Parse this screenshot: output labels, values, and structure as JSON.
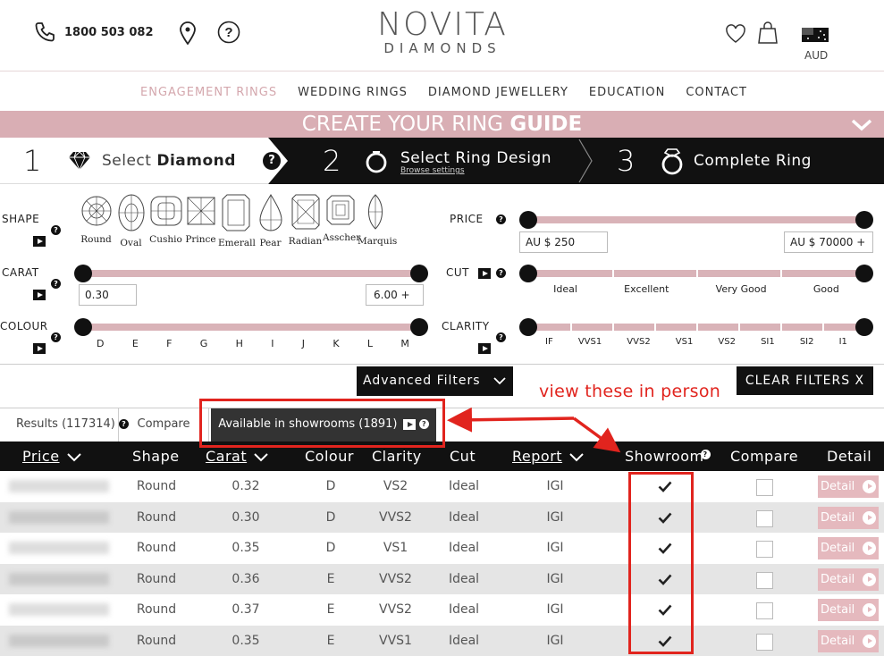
{
  "header": {
    "phone": "1800 503 082",
    "logo_line1": "NOVITA",
    "logo_line2": "DIAMONDS",
    "currency": "AUD",
    "icons": [
      "phone-icon",
      "location-pin-icon",
      "help-icon",
      "heart-icon",
      "shopping-bag-icon",
      "australia-flag-icon"
    ]
  },
  "nav": {
    "items": [
      "ENGAGEMENT RINGS",
      "WEDDING RINGS",
      "DIAMOND JEWELLERY",
      "EDUCATION",
      "CONTACT"
    ]
  },
  "guide": {
    "title_light": "CREATE YOUR RING ",
    "title_bold": "GUIDE"
  },
  "steps": [
    {
      "num": "1",
      "light": "Select ",
      "bold": "Diamond"
    },
    {
      "num": "2",
      "light": "Select ",
      "bold": "Ring Design",
      "sub": "Browse settings"
    },
    {
      "num": "3",
      "light": "Complete ",
      "bold": "Ring"
    }
  ],
  "filters": {
    "shape_label": "SHAPE",
    "shapes": [
      "Round",
      "Oval",
      "Cushio",
      "Prince",
      "Emerall",
      "Pear",
      "Radian",
      "Asscher",
      "Marquis"
    ],
    "carat_label": "CARAT",
    "carat_min": "0.30",
    "carat_max": "6.00 +",
    "colour_label": "COLOUR",
    "colours": [
      "D",
      "E",
      "F",
      "G",
      "H",
      "I",
      "J",
      "K",
      "L",
      "M"
    ],
    "price_label": "PRICE",
    "price_min": "AU $ 250",
    "price_max": "AU $ 70000 +",
    "cut_label": "CUT",
    "cuts": [
      "Ideal",
      "Excellent",
      "Very Good",
      "Good"
    ],
    "clarity_label": "CLARITY",
    "clarities": [
      "IF",
      "VVS1",
      "VVS2",
      "VS1",
      "VS2",
      "SI1",
      "SI2",
      "I1"
    ]
  },
  "actions": {
    "advanced": "Advanced Filters",
    "clear": "CLEAR FILTERS X"
  },
  "annotation": {
    "text": "view these in person",
    "color": "#e1241e"
  },
  "tabs": {
    "results": "Results (117314)",
    "compare": "Compare",
    "showrooms": "Available in showrooms (1891)"
  },
  "table": {
    "headers": {
      "price": "Price",
      "shape": "Shape",
      "carat": "Carat",
      "colour": "Colour",
      "clarity": "Clarity",
      "cut": "Cut",
      "report": "Report",
      "showroom": "Showroom",
      "compare": "Compare",
      "detail": "Detail"
    },
    "detail_label": "Detail",
    "rows": [
      {
        "shape": "Round",
        "carat": "0.32",
        "colour": "D",
        "clarity": "VS2",
        "cut": "Ideal",
        "report": "IGI"
      },
      {
        "shape": "Round",
        "carat": "0.30",
        "colour": "D",
        "clarity": "VVS2",
        "cut": "Ideal",
        "report": "IGI"
      },
      {
        "shape": "Round",
        "carat": "0.35",
        "colour": "D",
        "clarity": "VS1",
        "cut": "Ideal",
        "report": "IGI"
      },
      {
        "shape": "Round",
        "carat": "0.36",
        "colour": "E",
        "clarity": "VVS2",
        "cut": "Ideal",
        "report": "IGI"
      },
      {
        "shape": "Round",
        "carat": "0.37",
        "colour": "E",
        "clarity": "VVS2",
        "cut": "Ideal",
        "report": "IGI"
      },
      {
        "shape": "Round",
        "carat": "0.35",
        "colour": "E",
        "clarity": "VVS1",
        "cut": "Ideal",
        "report": "IGI"
      }
    ]
  },
  "colors": {
    "accent_pink": "#d9aeb4",
    "nav_active": "#d4a7ad",
    "dark": "#111111"
  }
}
